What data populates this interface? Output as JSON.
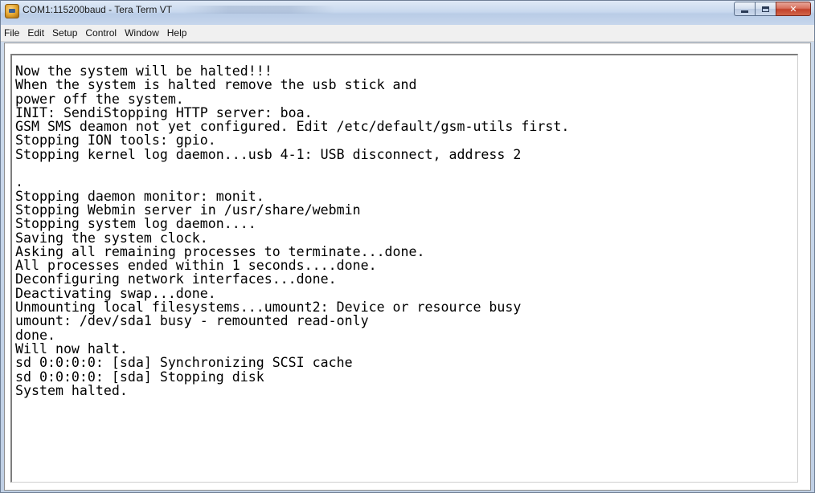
{
  "window": {
    "title": "COM1:115200baud - Tera Term VT"
  },
  "menu": {
    "items": [
      {
        "label": "File"
      },
      {
        "label": "Edit"
      },
      {
        "label": "Setup"
      },
      {
        "label": "Control"
      },
      {
        "label": "Window"
      },
      {
        "label": "Help"
      }
    ]
  },
  "terminal": {
    "lines": [
      "Now the system will be halted!!!",
      "When the system is halted remove the usb stick and",
      "power off the system.",
      "INIT: SendiStopping HTTP server: boa.",
      "GSM SMS deamon not yet configured. Edit /etc/default/gsm-utils first.",
      "Stopping ION tools: gpio.",
      "Stopping kernel log daemon...usb 4-1: USB disconnect, address 2",
      "",
      ".",
      "Stopping daemon monitor: monit.",
      "Stopping Webmin server in /usr/share/webmin",
      "Stopping system log daemon....",
      "Saving the system clock.",
      "Asking all remaining processes to terminate...done.",
      "All processes ended within 1 seconds....done.",
      "Deconfiguring network interfaces...done.",
      "Deactivating swap...done.",
      "Unmounting local filesystems...umount2: Device or resource busy",
      "umount: /dev/sda1 busy - remounted read-only",
      "done.",
      "Will now halt.",
      "sd 0:0:0:0: [sda] Synchronizing SCSI cache",
      "sd 0:0:0:0: [sda] Stopping disk",
      "System halted."
    ]
  },
  "icons": {
    "app": "tera-term-icon",
    "minimize": "minimize-icon",
    "maximize": "maximize-icon",
    "close": "close-icon"
  },
  "colors": {
    "terminal_background": "#ffffff",
    "terminal_text": "#000000",
    "close_button": "#c2422b"
  }
}
